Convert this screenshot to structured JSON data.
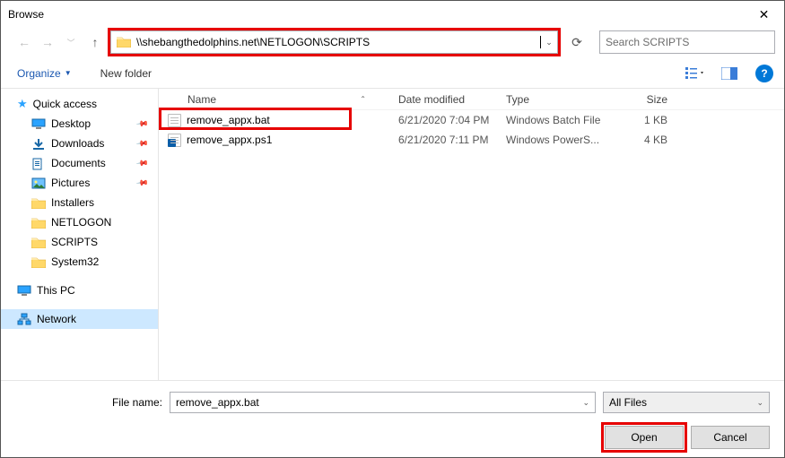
{
  "title": "Browse",
  "address": "\\\\shebangthedolphins.net\\NETLOGON\\SCRIPTS",
  "search_placeholder": "Search SCRIPTS",
  "toolbar": {
    "organize": "Organize",
    "newfolder": "New folder"
  },
  "sidebar": {
    "items": [
      {
        "label": "Quick access",
        "icon": "star",
        "bold": false
      },
      {
        "label": "Desktop",
        "icon": "monitor",
        "pinned": true,
        "indent": true
      },
      {
        "label": "Downloads",
        "icon": "down",
        "pinned": true,
        "indent": true
      },
      {
        "label": "Documents",
        "icon": "docs",
        "pinned": true,
        "indent": true
      },
      {
        "label": "Pictures",
        "icon": "pics",
        "pinned": true,
        "indent": true
      },
      {
        "label": "Installers",
        "icon": "folder",
        "indent": true
      },
      {
        "label": "NETLOGON",
        "icon": "folder",
        "indent": true
      },
      {
        "label": "SCRIPTS",
        "icon": "folder",
        "indent": true
      },
      {
        "label": "System32",
        "icon": "folder",
        "indent": true
      },
      {
        "label": "This PC",
        "icon": "monitor"
      },
      {
        "label": "Network",
        "icon": "network",
        "selected": true
      }
    ]
  },
  "columns": {
    "name": "Name",
    "date": "Date modified",
    "type": "Type",
    "size": "Size"
  },
  "files": [
    {
      "name": "remove_appx.bat",
      "date": "6/21/2020 7:04 PM",
      "type": "Windows Batch File",
      "size": "1 KB",
      "icon": "bat",
      "highlight": true
    },
    {
      "name": "remove_appx.ps1",
      "date": "6/21/2020 7:11 PM",
      "type": "Windows PowerS...",
      "size": "4 KB",
      "icon": "ps1"
    }
  ],
  "footer": {
    "label": "File name:",
    "value": "remove_appx.bat",
    "filter": "All Files",
    "open": "Open",
    "cancel": "Cancel"
  }
}
